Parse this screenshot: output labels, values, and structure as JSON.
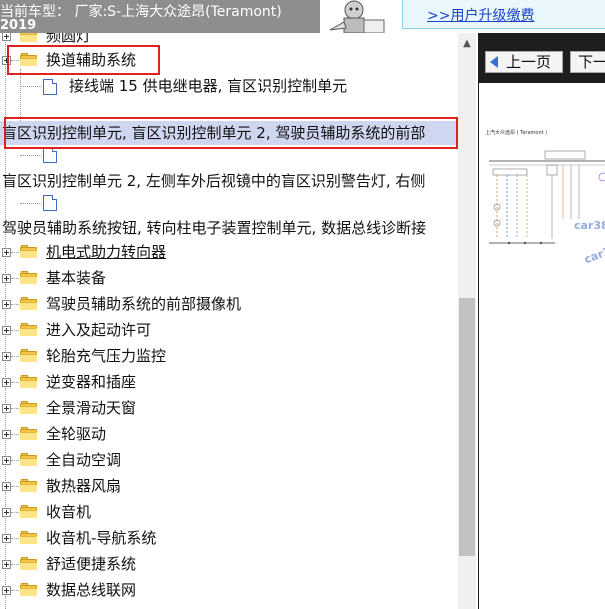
{
  "header": {
    "car_info": "当前车型：  厂家:S-上海大众途昂(Teramont)",
    "car_year": "2019",
    "upgrade_link": ">>用户升级缴费"
  },
  "tree": {
    "partial_top": "频圆灯",
    "root_folder": "换道辅助系统",
    "doc_label_1": "接线端 15 供电继电器, 盲区识别控制单元",
    "selected_row": "盲区识别控制单元, 盲区识别控制单元 2, 驾驶员辅助系统的前部",
    "row_2": "盲区识别控制单元 2, 左侧车外后视镜中的盲区识别警告灯, 右侧",
    "row_3": "驾驶员辅助系统按钮, 转向柱电子装置控制单元, 数据总线诊断接",
    "folders": [
      "机电式助力转向器",
      "基本装备",
      "驾驶员辅助系统的前部摄像机",
      "进入及起动许可",
      "轮胎充气压力监控",
      "逆变器和插座",
      "全景滑动天窗",
      "全轮驱动",
      "全自动空调",
      "散热器风扇",
      "收音机",
      "收音机-导航系统",
      "舒适便捷系统",
      "数据总线联网"
    ]
  },
  "viewer": {
    "prev_button": "上一页",
    "next_button": "下一",
    "diagram_title": "上汽大众途昂 ( Teramont )",
    "watermark_1": "car38",
    "watermark_2": "car3"
  },
  "colors": {
    "header_bar": "#8e8e8e",
    "selection": "#cfd6f0",
    "annotation_red": "#e0201a",
    "link_blue": "#1a44c8",
    "toolbar_dark": "#1e1e1e"
  }
}
